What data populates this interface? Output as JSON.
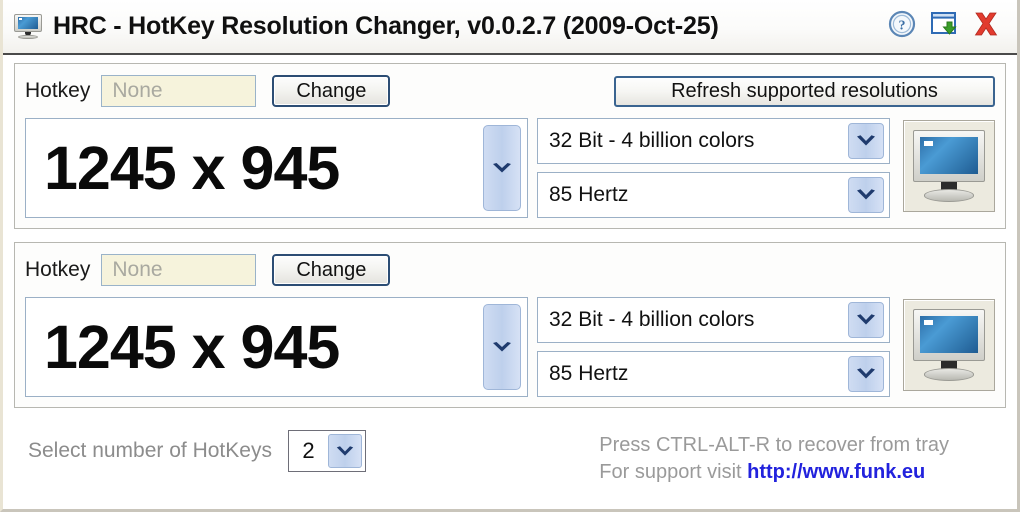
{
  "window": {
    "title": "HRC - HotKey Resolution Changer, v0.0.2.7 (2009-Oct-25)",
    "app_icon": "monitor-icon",
    "buttons": [
      {
        "name": "help-button",
        "icon": "help-question-icon"
      },
      {
        "name": "minimize-to-tray-button",
        "icon": "window-down-arrow-icon"
      },
      {
        "name": "close-button",
        "icon": "close-x-icon"
      }
    ]
  },
  "colors": {
    "accent_blue": "#2c4d74",
    "combo_arrow_blue": "#bed0ec",
    "chevron_navy": "#1f3b6e",
    "hotkey_field_bg": "#f6f3dc",
    "link_blue": "#2222dd",
    "muted_text": "#9a9a9a",
    "close_red": "#e03a2f",
    "screen_blue": "#2d6ea8",
    "panel_border": "#b7b7b1"
  },
  "panels": [
    {
      "hotkey_label": "Hotkey",
      "hotkey_value": "None",
      "hotkey_placeholder": "None",
      "change_label": "Change",
      "refresh_label": "Refresh supported resolutions",
      "resolution": "1245 x 945",
      "color_depth": "32 Bit - 4 billion colors",
      "refresh_rate": "85 Hertz",
      "preview_icon": "monitor-preview-icon"
    },
    {
      "hotkey_label": "Hotkey",
      "hotkey_value": "None",
      "hotkey_placeholder": "None",
      "change_label": "Change",
      "refresh_label": "",
      "resolution": "1245 x 945",
      "color_depth": "32 Bit - 4 billion colors",
      "refresh_rate": "85 Hertz",
      "preview_icon": "monitor-preview-icon"
    }
  ],
  "footer": {
    "select_label": "Select number of HotKeys",
    "hotkey_count": "2",
    "tray_hint": "Press CTRL-ALT-R to recover from tray",
    "support_prefix": "For support visit ",
    "support_url": "http://www.funk.eu"
  }
}
